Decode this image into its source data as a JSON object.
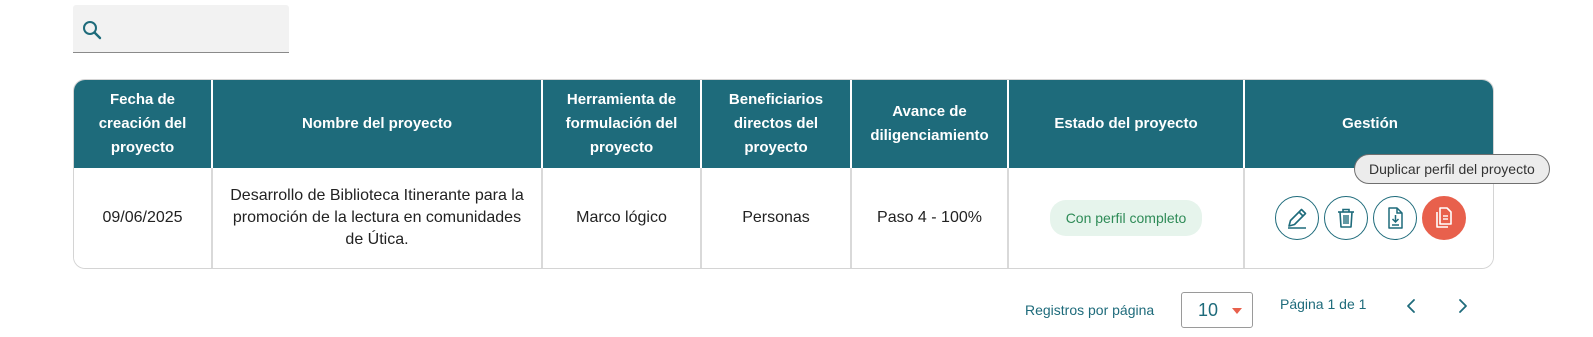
{
  "search": {
    "value": "",
    "placeholder": ""
  },
  "table": {
    "headers": [
      "Fecha de creación del proyecto",
      "Nombre del proyecto",
      "Herramienta de formulación del proyecto",
      "Beneficiarios directos del proyecto",
      "Avance de diligenciamiento",
      "Estado del proyecto",
      "Gestión"
    ],
    "rows": [
      {
        "fecha": "09/06/2025",
        "nombre": "Desarrollo de Biblioteca Itinerante para la promoción de la lectura en comunidades de Útica.",
        "herramienta": "Marco lógico",
        "beneficiarios": "Personas",
        "avance": "Paso 4 - 100%",
        "estado": "Con perfil completo",
        "actions": [
          "edit-icon",
          "trash-icon",
          "download-icon",
          "duplicate-icon"
        ]
      }
    ]
  },
  "tooltip": "Duplicar perfil del proyecto",
  "pagination": {
    "per_page_label": "Registros por página",
    "per_page_value": "10",
    "page_info": "Página 1 de 1"
  },
  "colors": {
    "header_bg": "#1e6b7b",
    "accent": "#e8604c",
    "badge_bg": "#e6f4ec",
    "badge_text": "#2e8b57"
  }
}
